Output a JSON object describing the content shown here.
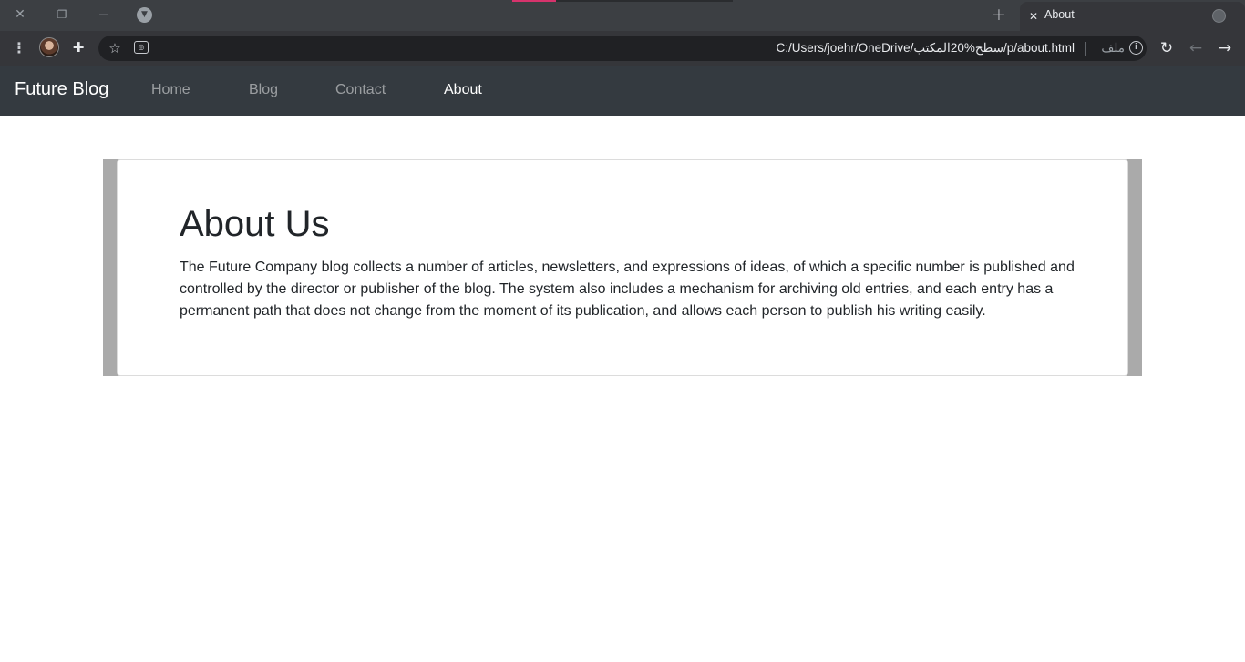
{
  "browser": {
    "window_controls": {
      "close": "✕",
      "restore": "❐",
      "minimize": "—"
    },
    "new_tab": "+",
    "active_tab": {
      "title": "About",
      "close": "✕"
    },
    "address_bar": {
      "url": "C:/Users/joehr/OneDrive/سطح%20المكتب/p/about.html",
      "scheme_label": "ملف"
    },
    "accent": "#d6336c"
  },
  "site": {
    "brand": "Future Blog",
    "nav": [
      {
        "label": "Home",
        "active": false
      },
      {
        "label": "Blog",
        "active": false
      },
      {
        "label": "Contact",
        "active": false
      },
      {
        "label": "About",
        "active": true
      }
    ]
  },
  "content": {
    "title": "About Us",
    "body": "The Future Company blog collects a number of articles, newsletters, and expressions of ideas, of which a specific number is published and controlled by the director or publisher of the blog. The system also includes a mechanism for archiving old entries, and each entry has a permanent path that does not change from the moment of its publication, and allows each person to publish his writing easily."
  }
}
